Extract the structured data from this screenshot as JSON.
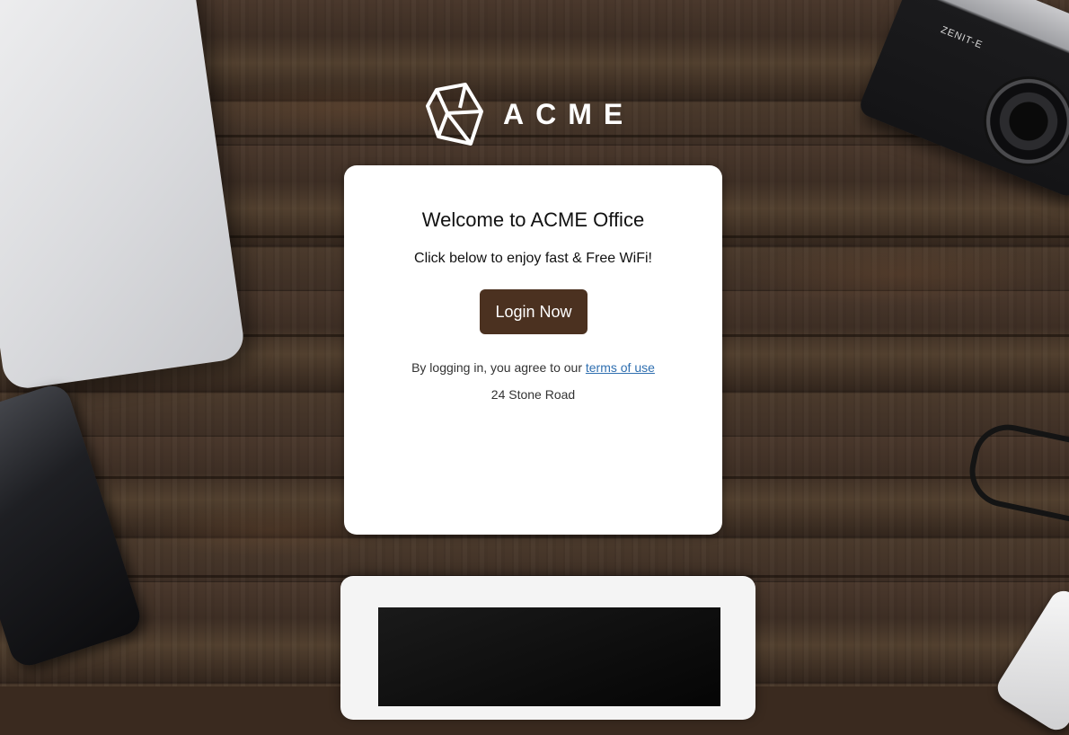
{
  "brand": {
    "name": "ACME",
    "logo_icon": "cube-outline-icon"
  },
  "card": {
    "title": "Welcome to ACME Office",
    "subtitle": "Click below to enjoy fast & Free WiFi!",
    "login_label": "Login Now",
    "terms_prefix": "By logging in, you agree to our ",
    "terms_link": "terms of use",
    "address": "24 Stone Road"
  },
  "background": {
    "camera_label": "ZENIT-E"
  },
  "colors": {
    "button": "#4b3120",
    "link": "#2f6fb0",
    "card": "#ffffff"
  }
}
